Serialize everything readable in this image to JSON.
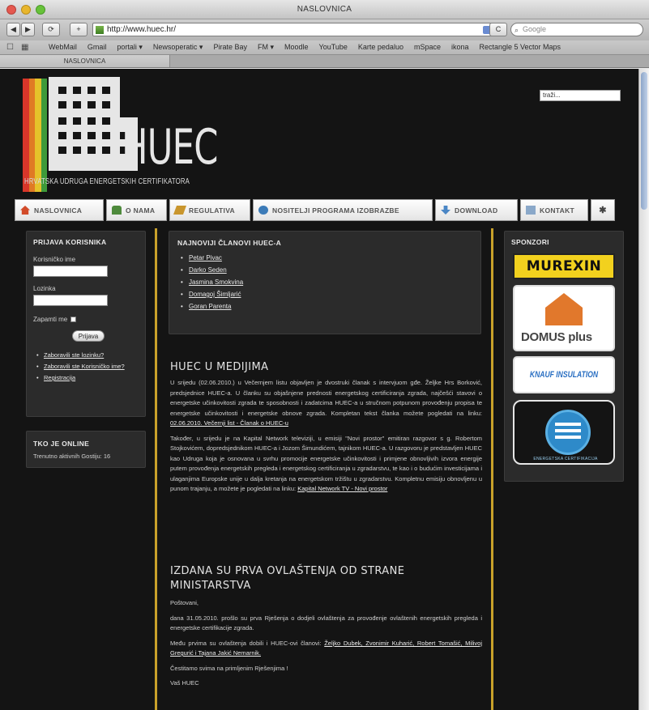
{
  "browser": {
    "window_title": "NASLOVNICA",
    "url": "http://www.huec.hr/",
    "search_placeholder": "Google",
    "bookmarks": [
      "WebMail",
      "Gmail",
      "portali ▾",
      "Newsoperatic ▾",
      "Pirate Bay",
      "FM ▾",
      "Moodle",
      "YouTube",
      "Karte pedaluo",
      "mSpace",
      "ikona",
      "Rectangle 5 Vector Maps"
    ],
    "tab_title": "NASLOVNICA"
  },
  "site": {
    "logo_text": "HUEC",
    "logo_subtitle": "HRVATSKA UDRUGA ENERGETSKIH CERTIFIKATORA",
    "search_value": "traži...",
    "logo_colors": [
      "#d8362a",
      "#e07a24",
      "#e5c22a",
      "#3e9a3a"
    ],
    "accent": "#c9a12a"
  },
  "nav": [
    {
      "label": "NASLOVNICA",
      "icon": "home-icon",
      "color": "#d24b2a"
    },
    {
      "label": "O NAMA",
      "icon": "people-icon",
      "color": "#4e8a3c"
    },
    {
      "label": "REGULATIVA",
      "icon": "pencil-icon",
      "color": "#c9962d"
    },
    {
      "label": "NOSITELJI PROGRAMA IZOBRAZBE",
      "icon": "group-icon",
      "color": "#3c7bb8"
    },
    {
      "label": "DOWNLOAD",
      "icon": "download-icon",
      "color": "#4a86c5"
    },
    {
      "label": "KONTAKT",
      "icon": "contact-icon",
      "color": "#8aa8c9"
    }
  ],
  "login": {
    "title": "PRIJAVA KORISNIKA",
    "username_label": "Korisničko ime",
    "password_label": "Lozinka",
    "remember_label": "Zapamti me",
    "button": "Prijava",
    "links": [
      "Zaboravili ste lozinku?",
      "Zaboravili ste Korisničko ime?",
      "Registracija"
    ]
  },
  "online": {
    "title": "TKO JE ONLINE",
    "text": "Trenutno aktivnih Gostiju: 16"
  },
  "members": {
    "title": "NAJNOVIJI ČLANOVI HUEC-A",
    "items": [
      "Petar Pivac",
      "Darko Seden",
      "Jasmina Smokvina",
      "Domagoj Šimljarić",
      "Goran Parenta"
    ]
  },
  "article1": {
    "title": "HUEC U MEDIJIMA",
    "p1a": "U srijedu (02.06.2010.) u Večernjem listu objavljen je dvostruki članak s intervjuom gđe. Željke Hrs Borković, predsjednice HUEC-a. U članku su objašnjene prednosti energetskog certificiranja zgrada, najčešći stavovi o energetske učinkovitosti zgrada te sposobnosti i zadatcima HUEC-a u stručnom potpunom provođenju propisa te energetske učinkovitosti i energetske obnove zgrada. Kompletan tekst članka možete pogledati na linku: ",
    "p1_link": "02.06.2010. Večernji list - Članak o HUEC-u",
    "p2a": "Također, u srijedu je na Kapital Network televiziji, u emisiji \"Novi prostor\" emitiran razgovor s g. Robertom Stojkovićem, dopredsjednikom HUEC-a i Jozom Šimundićem, tajnikom HUEC-a. U razgovoru je predstavljen HUEC kao Udruga koja je osnovana u svrhu promocije energetske učinkovitosti i primjene obnovljivih izvora energije putem provođenja energetskih pregleda i energetskog certificiranja u zgradarstvu, te kao i o budućim investicijama i ulaganjima Europske unije u dalja kretanja na energetskom tržištu u zgradarstvu. Kompletnu emisiju obnovljenu u punom trajanju, a možete je pogledati na linku: ",
    "p2_link": "Kapital Network TV - Novi prostor"
  },
  "article2": {
    "title": "IZDANA SU PRVA OVLAŠTENJA OD STRANE MINISTARSTVA",
    "greeting": "Poštovani,",
    "p1": "dana 31.05.2010. prošlo su prva Rješenja o dodjeli ovlaštenja za provođenje ovlaštenih energetskih pregleda i energetske certifikacije zgrada.",
    "p2a": "Među prvima su ovlaštenja dobili i HUEC-ovi članovi: ",
    "p2_links": "Željko Dubek, Zvonimir Kuharić, Robert Tomašić, Milivoj Gregurić i Tajana Jakić Nemarnik.",
    "p3": "Čestitamo svima na primljenim Rješenjima !",
    "sign": "Vaš HUEC"
  },
  "sponsors": {
    "title": "SPONZORI",
    "items": [
      "MUREXIN",
      "DOMUS plus",
      "KNAUF INSULATION",
      "ENERGETSKA CERTIFIKACIJA"
    ]
  }
}
